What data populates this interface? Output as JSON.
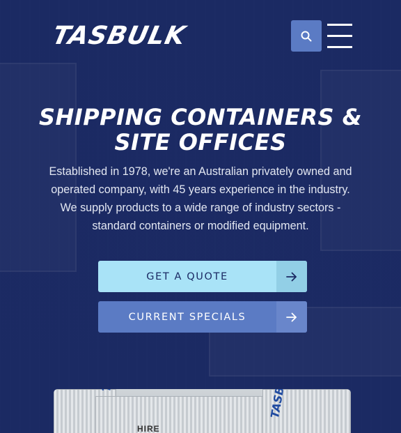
{
  "header": {
    "logo_text": "TASBULK",
    "search_icon": "search-icon",
    "menu_icon": "hamburger-menu-icon"
  },
  "hero": {
    "title_line1": "SHIPPING CONTAINERS &",
    "title_line2": "SITE OFFICES",
    "description": "Established in 1978, we're an Australian privately owned and operated company, with 45 years experience in the industry. We supply products to a wide range of industry sectors - standard containers or modified equipment."
  },
  "buttons": {
    "quote_label": "GET A QUOTE",
    "specials_label": "CURRENT SPECIALS",
    "arrow_icon": "arrow-right-icon"
  },
  "photo": {
    "brand_text": "TASBULK",
    "hire_text": "HIRE"
  },
  "colors": {
    "background": "#1b2a63",
    "accent_blue": "#5b7bc4",
    "light_cyan": "#a9e3f7",
    "white": "#ffffff"
  }
}
